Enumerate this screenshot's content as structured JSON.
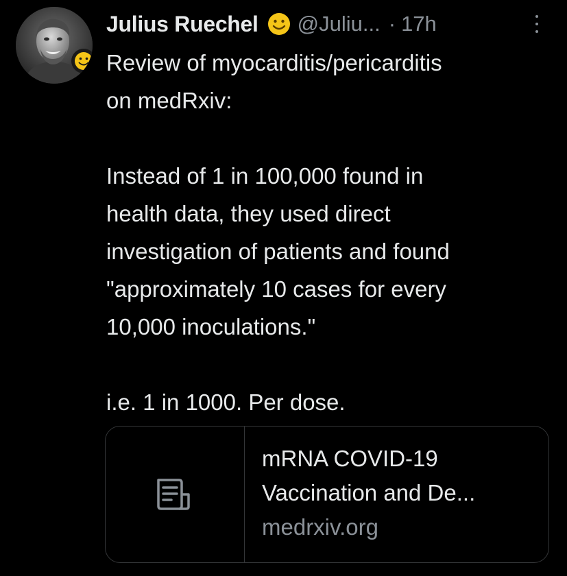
{
  "tweet": {
    "author": {
      "display_name": "Julius Ruechel",
      "name_emoji": "smiley-face-icon",
      "handle": "@Juliu...",
      "separator": "·",
      "time": "17h"
    },
    "more_icon": "more-vertical-icon",
    "text": {
      "paragraph_1": [
        "Review of myocarditis/pericarditis",
        "on medRxiv:"
      ],
      "paragraph_2": [
        "Instead of 1 in 100,000 found in",
        "health data, they used direct",
        "investigation of patients and found",
        "\"approximately 10 cases for every",
        "10,000 inoculations.\""
      ],
      "paragraph_3": [
        "i.e. 1 in 1000. Per dose."
      ]
    },
    "link_card": {
      "icon": "document-icon",
      "title_lines": [
        "mRNA COVID-19",
        "Vaccination and De..."
      ],
      "domain": "medrxiv.org"
    }
  },
  "colors": {
    "background": "#000000",
    "primary_text": "#e7e9ea",
    "secondary_text": "#8b9198",
    "border": "#343638",
    "emoji_yellow": "#f5c518"
  }
}
